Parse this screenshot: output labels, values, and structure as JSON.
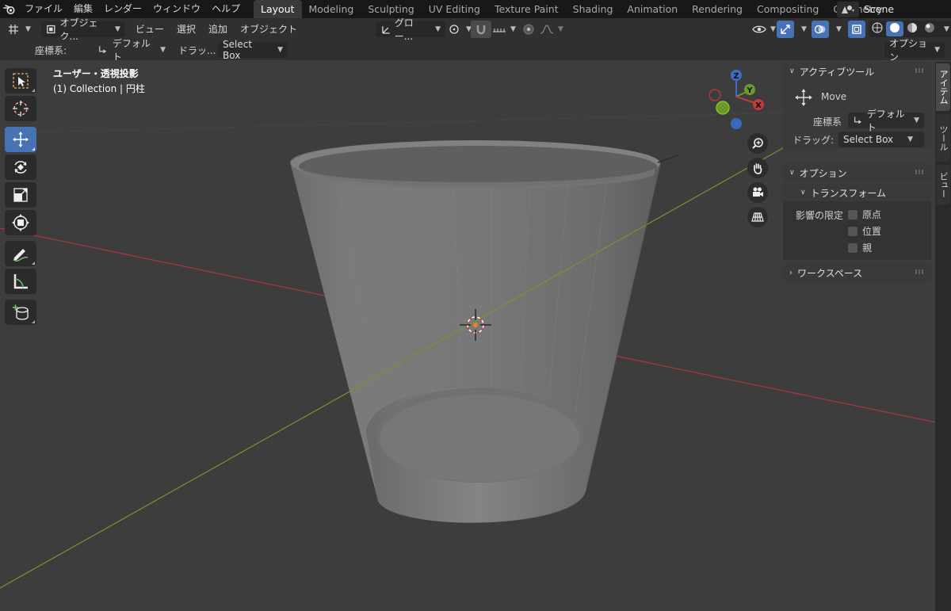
{
  "menu": {
    "items": [
      "ファイル",
      "編集",
      "レンダー",
      "ウィンドウ",
      "ヘルプ"
    ]
  },
  "workspaces": {
    "tabs": [
      "Layout",
      "Modeling",
      "Sculpting",
      "UV Editing",
      "Texture Paint",
      "Shading",
      "Animation",
      "Rendering",
      "Compositing",
      "Geometry"
    ],
    "active": "Layout"
  },
  "scene": {
    "name": "Scene"
  },
  "header": {
    "mode": "オブジェク...",
    "view": "ビュー",
    "select": "選択",
    "add": "追加",
    "object": "オブジェクト",
    "orientation": "グロー..."
  },
  "toolsettings": {
    "coord_label": "座標系:",
    "coord_value": "デフォルト",
    "drag_label": "ドラッ...",
    "drag_value": "Select Box",
    "options": "オプション"
  },
  "viewport": {
    "view_name": "ユーザー・透視投影",
    "collection": "(1) Collection | 円柱"
  },
  "gizmo": {
    "x": "X",
    "y": "Y",
    "z": "Z"
  },
  "npanel": {
    "active_tool_title": "アクティブツール",
    "tool_name": "Move",
    "coord_label": "座標系",
    "coord_value": "デフォルト",
    "drag_label": "ドラッグ:",
    "drag_value": "Select Box",
    "options_title": "オプション",
    "transform_title": "トランスフォーム",
    "affect_label": "影響の限定",
    "affect_items": [
      "原点",
      "位置",
      "親"
    ],
    "workspace_title": "ワークスペース"
  },
  "sidetabs": [
    "アイテム",
    "ツール",
    "ビュー"
  ],
  "colors": {
    "accent": "#4772b3",
    "x_axis": "#c2393f",
    "y_axis": "#6b9a2a",
    "z_axis": "#3a6ec6"
  }
}
